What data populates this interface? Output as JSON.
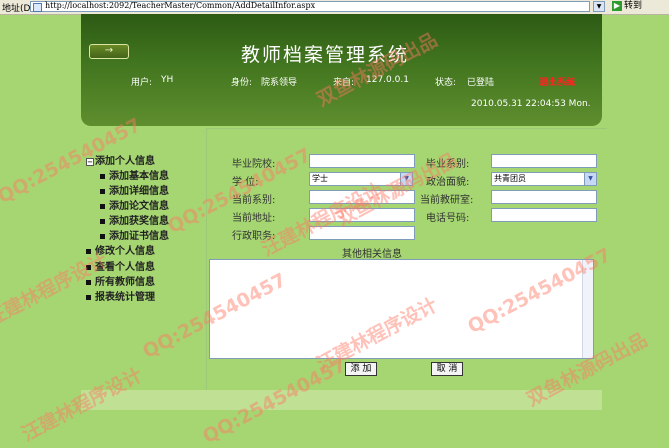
{
  "browser": {
    "address_label": "地址(D)",
    "url": "http://localhost:2092/TeacherMaster/Common/AddDetailInfor.aspx",
    "go_label": "转到"
  },
  "header": {
    "arrow": "→",
    "title": "教师档案管理系统",
    "user_label": "用户:",
    "user_value": "YH",
    "role_label": "身份:",
    "role_value": "院系领导",
    "from_label": "来自:",
    "from_value": "127.0.0.1",
    "status_label": "状态:",
    "status_value": "已登陆",
    "logout": "退出系统",
    "datetime": "2010.05.31  22:04:53  Mon."
  },
  "sidebar": {
    "group_label": "添加个人信息",
    "sub_items": [
      "添加基本信息",
      "添加详细信息",
      "添加论文信息",
      "添加获奖信息",
      "添加证书信息"
    ],
    "items": [
      "修改个人信息",
      "查看个人信息",
      "所有教师信息",
      "报表统计管理"
    ]
  },
  "form": {
    "graduate_school_label": "毕业院校:",
    "graduate_dept_label": "毕业系别:",
    "degree_label": "学  位:",
    "degree_value": "学士",
    "political_label": "政治面貌:",
    "political_value": "共青团员",
    "current_dept_label": "当前系别:",
    "current_office_label": "当前教研室:",
    "current_address_label": "当前地址:",
    "phone_label": "电话号码:",
    "admin_post_label": "行政职务:",
    "other_info_label": "其他相关信息",
    "add_button": "添 加",
    "cancel_button": "取 消"
  },
  "watermark": {
    "qq": "QQ:254540457",
    "brand": "双鱼林源码出品",
    "designer": "汪建林程序设计"
  },
  "colors": {
    "page_bg": "#a6d672",
    "header_dark": "#2c5a14",
    "logout_red": "#ff2222",
    "watermark": "#ff7864"
  }
}
